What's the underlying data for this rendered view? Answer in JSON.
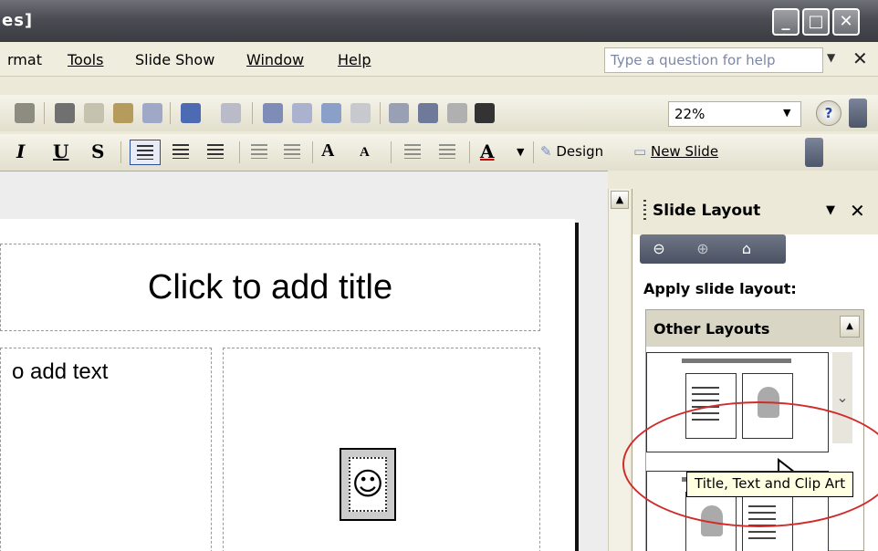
{
  "window": {
    "title": "es]",
    "controls": {
      "minimize": "_",
      "maximize": "□",
      "close": "✕"
    }
  },
  "menu": {
    "items": [
      "rmat",
      "Tools",
      "Slide Show",
      "Window",
      "Help"
    ],
    "help_placeholder": "Type a question for help",
    "close": "✕"
  },
  "toolbar": {
    "zoom": "22%",
    "format_bold_italic": [
      "I",
      "U",
      "S"
    ],
    "font_grow": "A",
    "font_shrink": "A",
    "font_color": "A",
    "design_label": "Design",
    "new_slide_label": "New Slide",
    "help_icon": "?"
  },
  "slide": {
    "title_placeholder": "Click to add title",
    "text_placeholder": "o add text"
  },
  "task_pane": {
    "title": "Slide Layout",
    "apply_label": "Apply slide layout:",
    "section": "Other Layouts",
    "tooltip": "Title, Text and Clip Art"
  },
  "colors": {
    "titlebar": "#4b4d54",
    "annotation_circle": "#d12b2b",
    "tooltip_bg": "#ffffe1"
  }
}
